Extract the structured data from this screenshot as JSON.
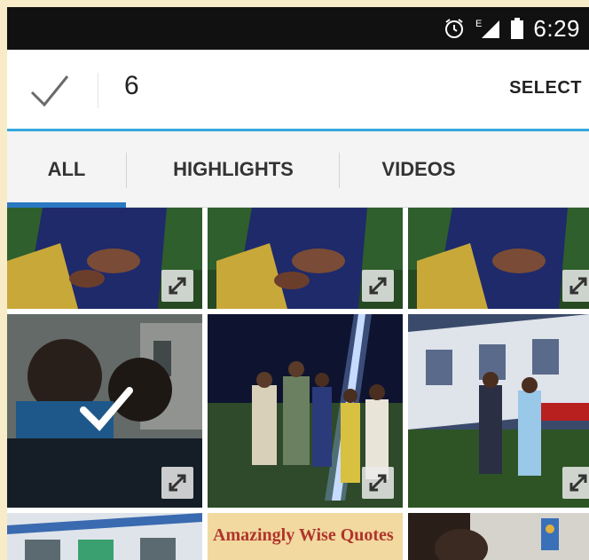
{
  "status_bar": {
    "time": "6:29",
    "icons": [
      "alarm-icon",
      "signal-icon",
      "battery-icon"
    ],
    "network_label": "E"
  },
  "action_bar": {
    "confirm_icon": "check-icon",
    "selected_count": "6",
    "select_label": "SELECT",
    "accent_color": "#34a8dd"
  },
  "tabs": {
    "items": [
      {
        "label": "ALL",
        "active": true
      },
      {
        "label": "HIGHLIGHTS",
        "active": false
      },
      {
        "label": "VIDEOS",
        "active": false
      }
    ],
    "indicator_color": "#2b78c2"
  },
  "grid": {
    "tiles": [
      {
        "name": "photo-couple-1",
        "selected": false,
        "expand_icon": true
      },
      {
        "name": "photo-couple-2",
        "selected": false,
        "expand_icon": true
      },
      {
        "name": "photo-couple-3",
        "selected": false,
        "expand_icon": true
      },
      {
        "name": "photo-selfie",
        "selected": true,
        "expand_icon": true
      },
      {
        "name": "photo-group-night",
        "selected": false,
        "expand_icon": true
      },
      {
        "name": "photo-campus",
        "selected": false,
        "expand_icon": true
      },
      {
        "name": "photo-building",
        "selected": false,
        "expand_icon": false
      },
      {
        "name": "photo-quote",
        "selected": false,
        "expand_icon": false,
        "caption": "Amazingly Wise Quotes"
      },
      {
        "name": "photo-portrait",
        "selected": false,
        "expand_icon": false
      }
    ]
  }
}
